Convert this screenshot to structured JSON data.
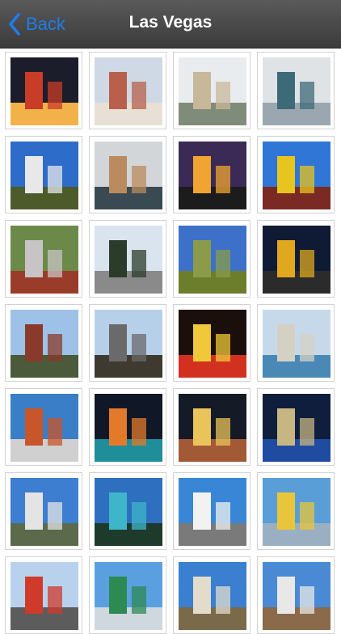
{
  "navbar": {
    "back_label": "Back",
    "title": "Las Vegas",
    "accent_color": "#1e7cf0"
  },
  "photos": [
    {
      "name": "photo-hotel-night-tower",
      "palette": [
        "#1b1d2a",
        "#c83c28",
        "#f2b24a"
      ]
    },
    {
      "name": "photo-hotel-day-wide",
      "palette": [
        "#cfd9e6",
        "#b8604c",
        "#e8e0d4"
      ]
    },
    {
      "name": "photo-casino-towers",
      "palette": [
        "#e8ecef",
        "#c8b89a",
        "#7f8c7a"
      ]
    },
    {
      "name": "photo-glass-towers",
      "palette": [
        "#dfe3e6",
        "#3d6a78",
        "#9aa7b0"
      ]
    },
    {
      "name": "photo-blue-sky-eiffel",
      "palette": [
        "#2d6cc9",
        "#e8e8e8",
        "#4d5a2a"
      ]
    },
    {
      "name": "photo-fountain-plaza",
      "palette": [
        "#d2d6d8",
        "#b98b5e",
        "#3a4a52"
      ]
    },
    {
      "name": "photo-palm-tree-sunset",
      "palette": [
        "#3b2a55",
        "#f0a431",
        "#1c1c1c"
      ]
    },
    {
      "name": "photo-mcdonalds-sign",
      "palette": [
        "#2f76d6",
        "#e8c41e",
        "#7a2a22"
      ]
    },
    {
      "name": "photo-flamingo",
      "palette": [
        "#6b8a4a",
        "#c8c3c5",
        "#9a3c2a"
      ]
    },
    {
      "name": "photo-palm-trees-street",
      "palette": [
        "#d9e4ef",
        "#2b3d2a",
        "#8a8a8a"
      ]
    },
    {
      "name": "photo-golf-course",
      "palette": [
        "#3d70c9",
        "#8a9c4a",
        "#6c7d2c"
      ]
    },
    {
      "name": "photo-sphinx-night",
      "palette": [
        "#0f1a35",
        "#e0a81e",
        "#2b2b2b"
      ]
    },
    {
      "name": "photo-pylon-sculpture",
      "palette": [
        "#9ec1e8",
        "#8a3a2a",
        "#4a5a3a"
      ]
    },
    {
      "name": "photo-building-mural",
      "palette": [
        "#b7d0ea",
        "#6a6a6a",
        "#3f3a30"
      ]
    },
    {
      "name": "photo-four-queens-sign",
      "palette": [
        "#1a0f0a",
        "#f0c93a",
        "#d2311f"
      ]
    },
    {
      "name": "photo-lake-hotel",
      "palette": [
        "#c6d9ea",
        "#d4d0c4",
        "#4a88b6"
      ]
    },
    {
      "name": "photo-red-building",
      "palette": [
        "#3a7ec8",
        "#c8562a",
        "#d0d0d0"
      ]
    },
    {
      "name": "photo-venetian-night",
      "palette": [
        "#101828",
        "#e37a2a",
        "#1f8e9a"
      ]
    },
    {
      "name": "photo-eiffel-night-lights",
      "palette": [
        "#141a26",
        "#e9c45a",
        "#a25a36"
      ]
    },
    {
      "name": "photo-bellagio-night",
      "palette": [
        "#0f1e3c",
        "#c8b682",
        "#1f4ca0"
      ]
    },
    {
      "name": "photo-white-hotel",
      "palette": [
        "#3d7ed0",
        "#e4e4e4",
        "#5a6a4a"
      ]
    },
    {
      "name": "photo-paris-fountain",
      "palette": [
        "#2f6fc0",
        "#3fb5c9",
        "#1d3a2a"
      ]
    },
    {
      "name": "photo-clouds-skyline",
      "palette": [
        "#3a86d6",
        "#f2f2f2",
        "#7a7a7a"
      ]
    },
    {
      "name": "photo-stratosphere-tower",
      "palette": [
        "#5a9ed8",
        "#e8c53a",
        "#9ab0c2"
      ]
    },
    {
      "name": "photo-eiffel-street",
      "palette": [
        "#b8d2ee",
        "#cf3a2a",
        "#5c5c5c"
      ]
    },
    {
      "name": "photo-coke-bottle",
      "palette": [
        "#5aa0e0",
        "#2c8a52",
        "#cfd8df"
      ]
    },
    {
      "name": "photo-caesars-fountain",
      "palette": [
        "#3a7fd0",
        "#e2dccd",
        "#7a6a4a"
      ]
    },
    {
      "name": "photo-statue-arena",
      "palette": [
        "#4a8ad4",
        "#e8e8e8",
        "#8a6a4a"
      ]
    }
  ]
}
